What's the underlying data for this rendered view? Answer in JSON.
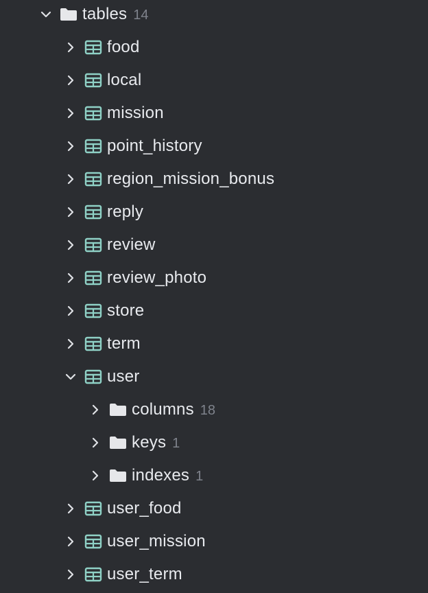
{
  "tree": [
    {
      "label": "tables",
      "count": "14",
      "icon": "folder-icon",
      "expanded": true,
      "depth": 0
    },
    {
      "label": "food",
      "count": "",
      "icon": "table-icon",
      "expanded": false,
      "depth": 1
    },
    {
      "label": "local",
      "count": "",
      "icon": "table-icon",
      "expanded": false,
      "depth": 1
    },
    {
      "label": "mission",
      "count": "",
      "icon": "table-icon",
      "expanded": false,
      "depth": 1
    },
    {
      "label": "point_history",
      "count": "",
      "icon": "table-icon",
      "expanded": false,
      "depth": 1
    },
    {
      "label": "region_mission_bonus",
      "count": "",
      "icon": "table-icon",
      "expanded": false,
      "depth": 1
    },
    {
      "label": "reply",
      "count": "",
      "icon": "table-icon",
      "expanded": false,
      "depth": 1
    },
    {
      "label": "review",
      "count": "",
      "icon": "table-icon",
      "expanded": false,
      "depth": 1
    },
    {
      "label": "review_photo",
      "count": "",
      "icon": "table-icon",
      "expanded": false,
      "depth": 1
    },
    {
      "label": "store",
      "count": "",
      "icon": "table-icon",
      "expanded": false,
      "depth": 1
    },
    {
      "label": "term",
      "count": "",
      "icon": "table-icon",
      "expanded": false,
      "depth": 1
    },
    {
      "label": "user",
      "count": "",
      "icon": "table-icon",
      "expanded": true,
      "depth": 1
    },
    {
      "label": "columns",
      "count": "18",
      "icon": "folder-icon",
      "expanded": false,
      "depth": 2
    },
    {
      "label": "keys",
      "count": "1",
      "icon": "folder-icon",
      "expanded": false,
      "depth": 2
    },
    {
      "label": "indexes",
      "count": "1",
      "icon": "folder-icon",
      "expanded": false,
      "depth": 2
    },
    {
      "label": "user_food",
      "count": "",
      "icon": "table-icon",
      "expanded": false,
      "depth": 1
    },
    {
      "label": "user_mission",
      "count": "",
      "icon": "table-icon",
      "expanded": false,
      "depth": 1
    },
    {
      "label": "user_term",
      "count": "",
      "icon": "table-icon",
      "expanded": false,
      "depth": 1
    }
  ],
  "colors": {
    "background": "#2b2d31",
    "text": "#e8eaee",
    "count": "#7f838c",
    "chevron": "#dfe1e5",
    "folder": "#e6e7ea",
    "table_icon": "#8fd1c6"
  }
}
